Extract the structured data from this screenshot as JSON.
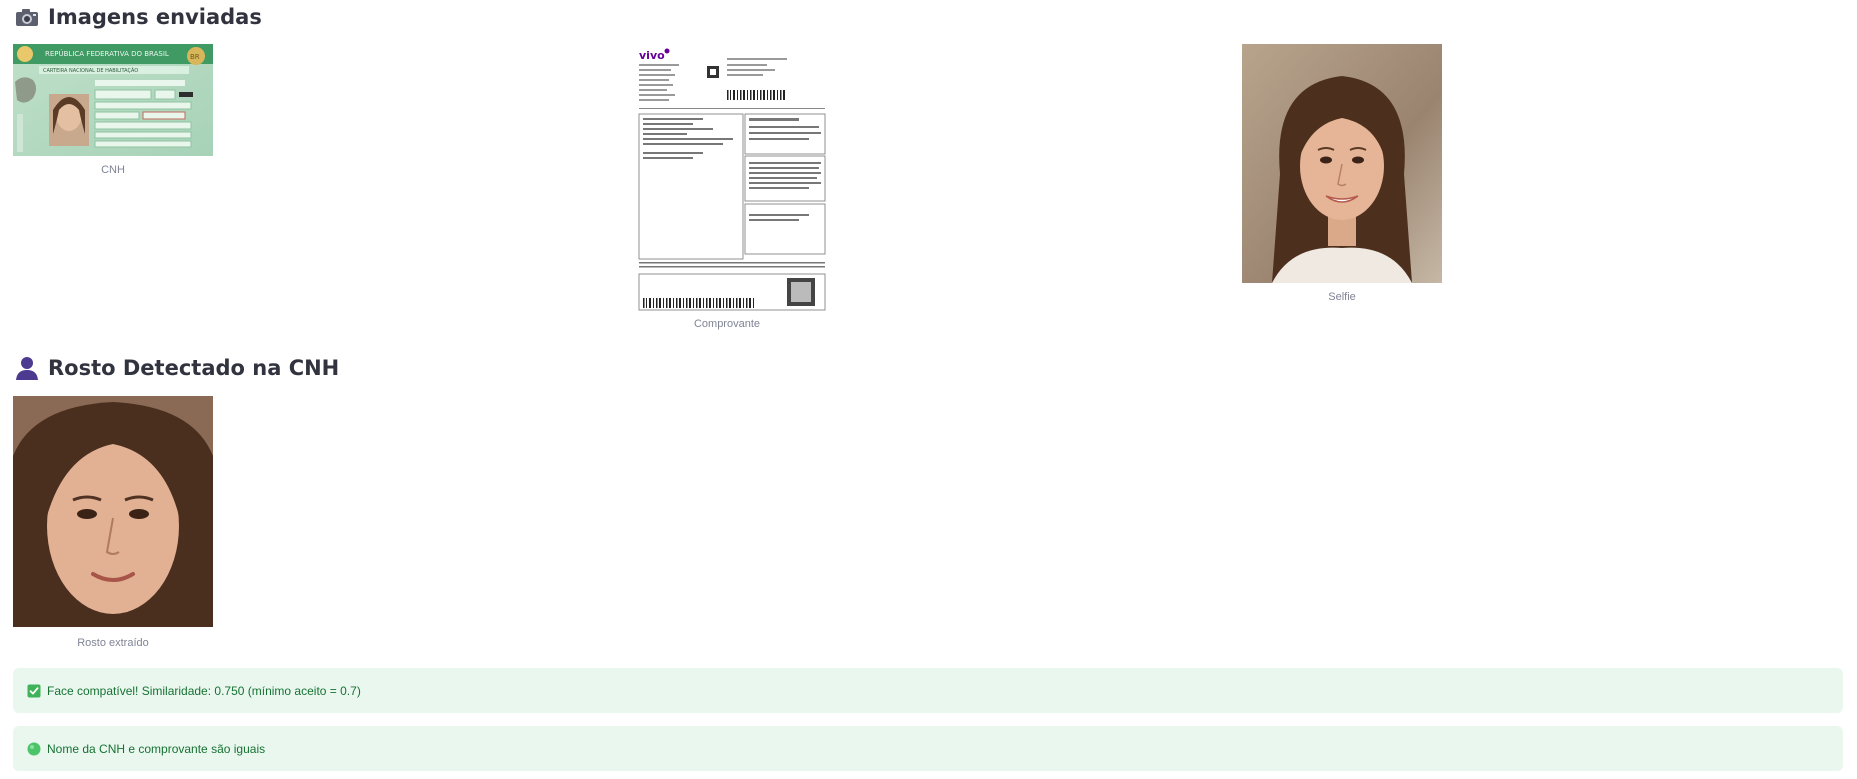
{
  "uploaded_section": {
    "title": "Imagens enviadas",
    "icon": "camera-icon",
    "images": [
      {
        "caption": "CNH",
        "kind": "drivers-license"
      },
      {
        "caption": "Comprovante",
        "kind": "utility-bill"
      },
      {
        "caption": "Selfie",
        "kind": "selfie-photo"
      }
    ],
    "cnh_text": {
      "header": "REPÚBLICA FEDERATIVA DO BRASIL",
      "sub": "CARTEIRA NACIONAL DE HABILITAÇÃO",
      "badge": "BR"
    },
    "bill_text": {
      "brand": "vivo"
    }
  },
  "face_section": {
    "title": "Rosto Detectado na CNH",
    "icon": "person-icon",
    "caption": "Rosto extraído"
  },
  "alerts": [
    {
      "icon": "check-icon",
      "text": "Face compatível! Similaridade: 0.750 (mínimo aceito = 0.7)"
    },
    {
      "icon": "green-circle-icon",
      "text": "Nome da CNH e comprovante são iguais"
    }
  ],
  "colors": {
    "success_bg": "#e9f7ee",
    "success_text": "#177233",
    "title_text": "#31333f",
    "caption_text": "#808495"
  }
}
